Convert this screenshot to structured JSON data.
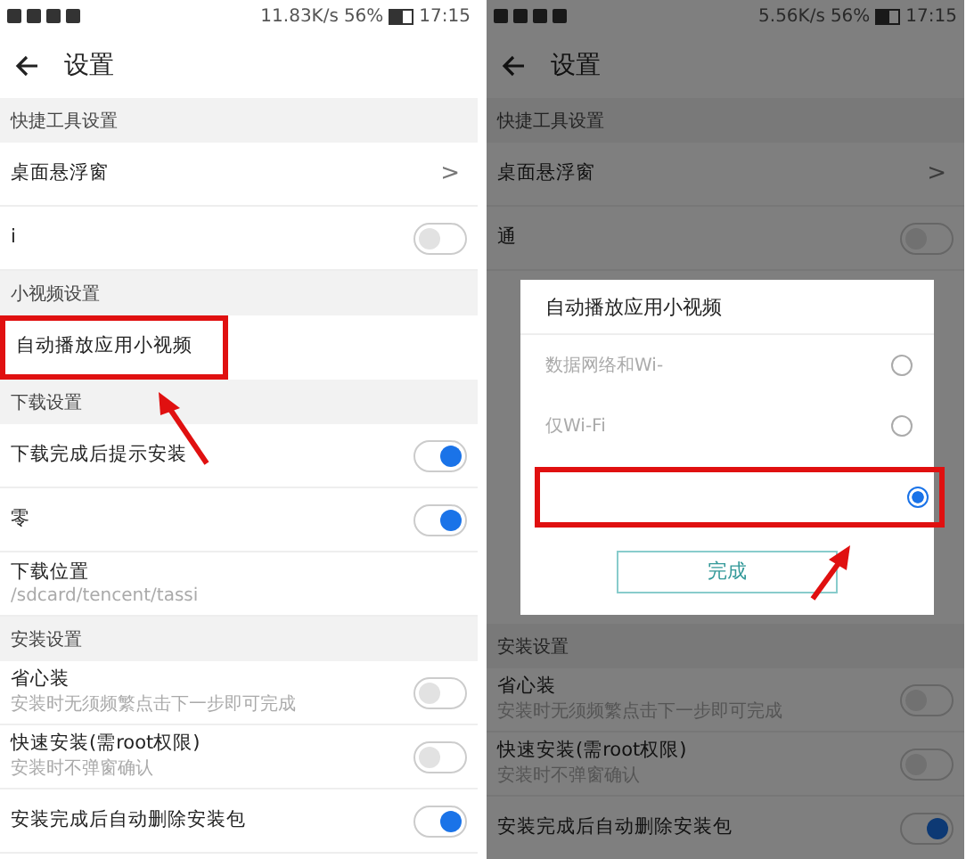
{
  "panels": [
    {
      "status": {
        "speed": "11.83K/s",
        "battery": "56%",
        "time": "17:15"
      },
      "title": "设置",
      "rows": [
        {
          "kind": "header",
          "label": "快捷工具设置",
          "highlighted": false
        },
        {
          "kind": "link",
          "label": "桌面悬浮窗",
          "chevron": ">",
          "highlighted": false
        },
        {
          "kind": "toggle",
          "label": "i",
          "on": false,
          "highlighted": false
        },
        {
          "kind": "header",
          "label": "小视频设置",
          "highlighted": false
        },
        {
          "kind": "plain",
          "label": "自动播放应用小视频",
          "highlighted": true
        },
        {
          "kind": "header",
          "label": "下载设置",
          "highlighted": false
        },
        {
          "kind": "toggle",
          "label": "下载完成后提示安装",
          "on": true,
          "highlighted": false
        },
        {
          "kind": "toggle",
          "label": "零",
          "on": true,
          "highlighted": false
        },
        {
          "kind": "path",
          "label": "下载位置",
          "sublabel": "/sdcard/tencent/tassi",
          "highlighted": false
        },
        {
          "kind": "header",
          "label": "安装设置",
          "highlighted": false
        },
        {
          "kind": "toggle",
          "label": "省心装",
          "sublabel": "安装时无须频繁点击下一步即可完成",
          "on": false,
          "highlighted": false
        },
        {
          "kind": "toggle",
          "label": "快速安装(需root权限)",
          "sublabel": "安装时不弹窗确认",
          "on": false,
          "highlighted": false
        },
        {
          "kind": "toggle",
          "label": "安装完成后自动删除安装包",
          "on": true,
          "highlighted": false
        }
      ]
    },
    {
      "status": {
        "speed": "5.56K/s",
        "battery": "56%",
        "time": "17:15"
      },
      "title": "设置",
      "dimmed": true,
      "rows": [
        {
          "kind": "header",
          "label": "快捷工具设置",
          "highlighted": false
        },
        {
          "kind": "link",
          "label": "桌面悬浮窗",
          "chevron": ">",
          "highlighted": false
        },
        {
          "kind": "toggle",
          "label": "通",
          "on": false,
          "highlighted": false
        }
      ],
      "dialog": {
        "title": "自动播放应用小视频",
        "options": [
          {
            "label": "数据网络和Wi-",
            "selected": false,
            "highlighted": false
          },
          {
            "label": "仅Wi-Fi",
            "selected": false,
            "highlighted": false
          },
          {
            "selected": true,
            "highlighted": true
          }
        ],
        "button": "完成"
      },
      "rows_after": [
        {
          "kind": "header",
          "label": "安装设置",
          "highlighted": false
        },
        {
          "kind": "toggle",
          "label": "省心装",
          "sublabel": "安装时无须频繁点击下一步即可完成",
          "on": false,
          "highlighted": false
        },
        {
          "kind": "toggle",
          "label": "快速安装(需root权限)",
          "sublabel": "安装时不弹窗确认",
          "on": false,
          "highlighted": false
        },
        {
          "kind": "toggle",
          "label": "安装完成后自动删除安装包",
          "on": true,
          "highlighted": false
        }
      ]
    }
  ]
}
